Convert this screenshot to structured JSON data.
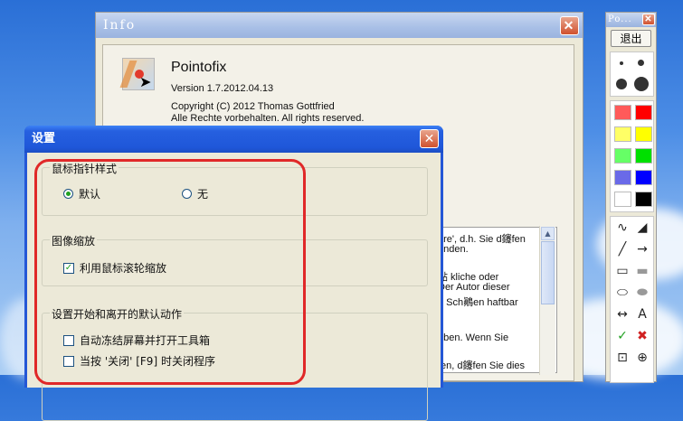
{
  "info_window": {
    "title": "Info",
    "app_name": "Pointofix",
    "version": "Version 1.7.2012.04.13",
    "copyright": "Copyright (C) 2012 Thomas Gottfried",
    "rights": "Alle Rechte vorbehalten. All rights reserved.",
    "license_lines": [
      "are', d.h. Sie d鑳fen",
      "enden.",
      "",
      "點 kliche oder",
      "Der Autor dieser",
      "n Sch鷆en haftbar",
      "",
      "",
      "eben. Wenn Sie",
      "",
      "ten, d鑳fen Sie dies"
    ]
  },
  "settings_dialog": {
    "title": "设置",
    "cursor_group": {
      "legend": "鼠标指针样式",
      "option_default": "默认",
      "option_none": "无"
    },
    "zoom_group": {
      "legend": "图像缩放",
      "option_wheel": "利用鼠标滚轮缩放"
    },
    "actions_group": {
      "legend": "设置开始和离开的默认动作",
      "option_freeze": "自动冻结屏幕并打开工具箱",
      "option_close": "当按 '关闭' [F9] 时关闭程序"
    }
  },
  "toolbar_window": {
    "title": "Po...",
    "exit_label": "退出",
    "colors": [
      "#ff5a5a",
      "#ff0000",
      "#ffff66",
      "#ffff00",
      "#66ff66",
      "#00e000",
      "#6a6ae8",
      "#0000ff",
      "#ffffff",
      "#000000"
    ],
    "annotation_color": "#e02828"
  }
}
